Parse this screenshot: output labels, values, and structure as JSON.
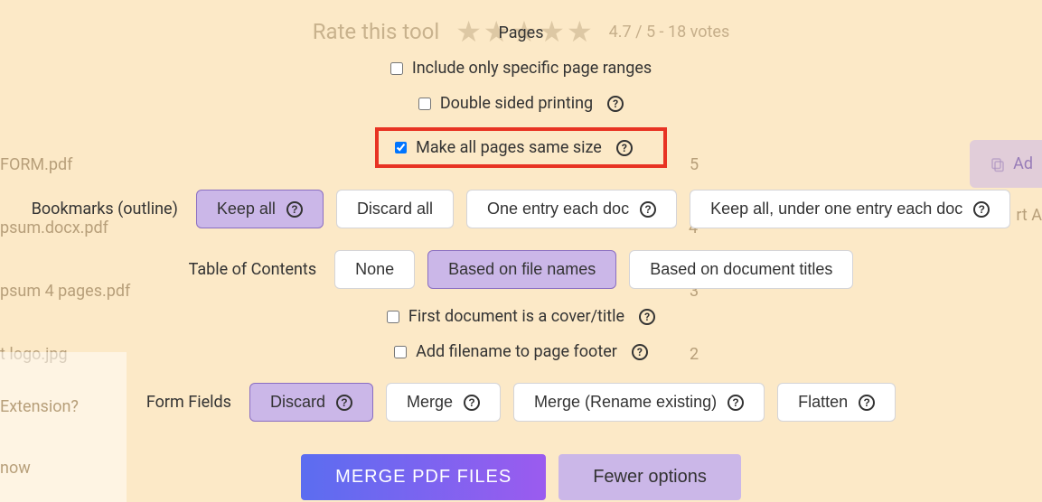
{
  "rating": {
    "label": "Rate this tool",
    "summary": "4.7 / 5 - 18 votes"
  },
  "pages": {
    "heading": "Pages",
    "opt_ranges": "Include only specific page ranges",
    "opt_double": "Double sided printing",
    "opt_samesize": "Make all pages same size"
  },
  "bookmarks": {
    "label": "Bookmarks (outline)",
    "keep_all": "Keep all",
    "discard_all": "Discard all",
    "one_each": "One entry each doc",
    "keep_under": "Keep all, under one entry each doc"
  },
  "toc": {
    "label": "Table of Contents",
    "none": "None",
    "filenames": "Based on file names",
    "titles": "Based on document titles"
  },
  "toc_opts": {
    "cover": "First document is a cover/title",
    "footer": "Add filename to page footer"
  },
  "form": {
    "label": "Form Fields",
    "discard": "Discard",
    "merge": "Merge",
    "rename": "Merge (Rename existing)",
    "flatten": "Flatten"
  },
  "actions": {
    "merge": "MERGE PDF FILES",
    "fewer": "Fewer options"
  },
  "bg": {
    "f1": " FORM.pdf",
    "f2": "psum.docx.pdf",
    "f3": "psum 4 pages.pdf",
    "f4": "t logo.jpg",
    "ext": " Extension?",
    "now": " now",
    "p5": "5",
    "p4": "4",
    "p3": "3",
    "p2": "2",
    "add": "Ad",
    "sort": "rt A"
  }
}
